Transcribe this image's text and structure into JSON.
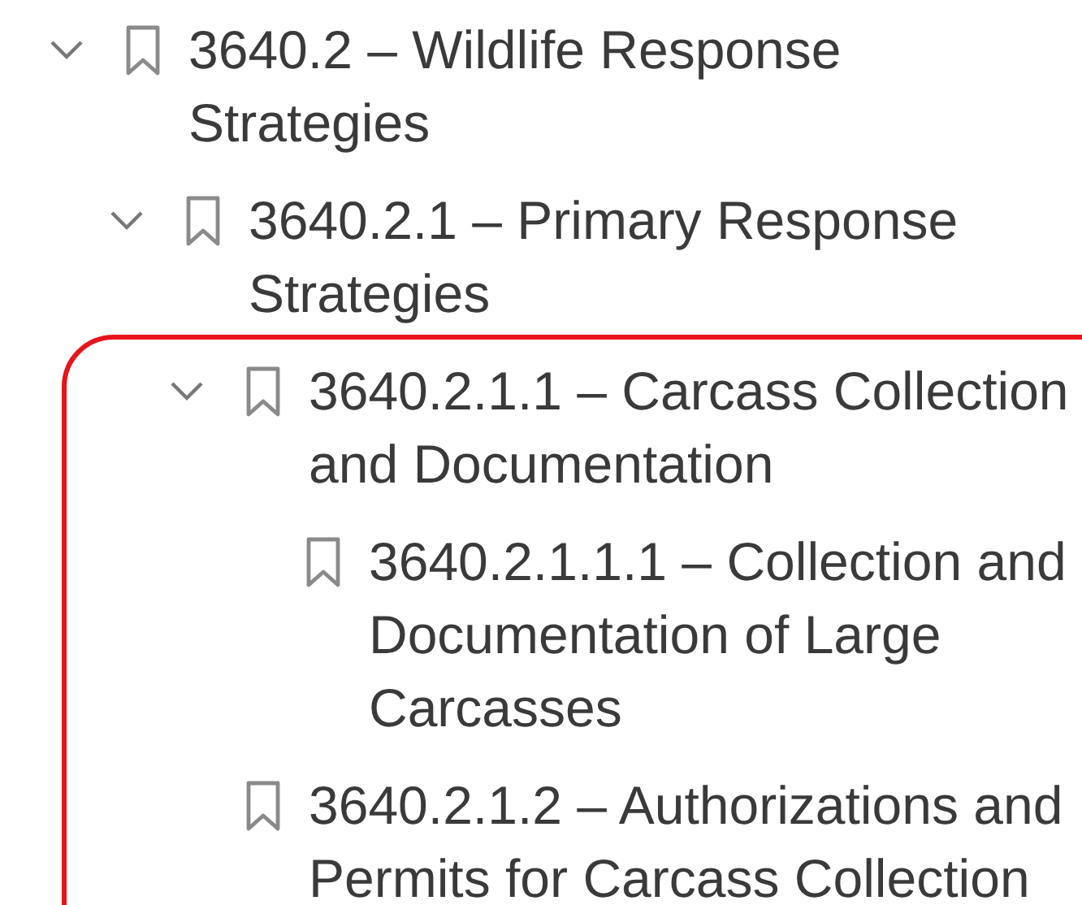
{
  "bookmarks": [
    {
      "label": "3640.2 – Wildlife Response Strategies",
      "expanded": true,
      "children_highlighted": false,
      "children": [
        {
          "label": "3640.2.1 – Primary Response Strategies",
          "expanded": true,
          "children_highlighted": true,
          "children": [
            {
              "label": "3640.2.1.1 – Carcass Collection and Documentation",
              "expanded": true,
              "children_highlighted": false,
              "children": [
                {
                  "label": "3640.2.1.1.1 – Collection and Documentation of Large Carcasses"
                }
              ]
            },
            {
              "label": "3640.2.1.2 – Authorizations and Permits for Carcass Collection"
            }
          ]
        }
      ]
    }
  ]
}
